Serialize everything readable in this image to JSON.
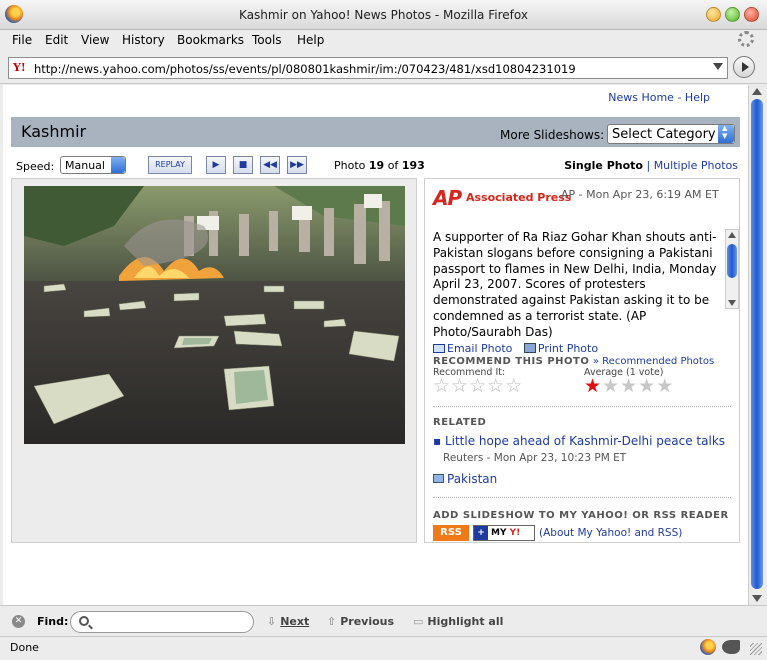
{
  "window": {
    "title": "Kashmir on Yahoo! News Photos - Mozilla Firefox"
  },
  "menu": [
    "File",
    "Edit",
    "View",
    "History",
    "Bookmarks",
    "Tools",
    "Help"
  ],
  "address": {
    "favicon_text": "Y!",
    "url": "http://news.yahoo.com/photos/ss/events/pl/080801kashmir/im:/070423/481/xsd10804231019"
  },
  "toplinks": {
    "home": "News Home",
    "sep": "-",
    "help": "Help"
  },
  "header": {
    "title": "Kashmir",
    "more_label": "More Slideshows:",
    "select_value": "Select Category"
  },
  "controls": {
    "speed_label": "Speed:",
    "speed_value": "Manual",
    "replay": "REPLAY",
    "photo_label": "Photo",
    "photo_num": "19",
    "of_label": "of",
    "photo_total": "193",
    "single": "Single Photo",
    "sep": "|",
    "multiple": "Multiple Photos"
  },
  "info": {
    "ap_logo": "AP",
    "ap_name": "Associated Press",
    "date": "AP - Mon Apr 23, 6:19 AM ET",
    "caption": "A supporter of Ra Riaz Gohar Khan shouts anti-Pakistan slogans before consigning a Pakistani passport to flames in New Delhi, India, Monday April 23, 2007. Scores of protesters demonstrated against Pakistan asking it to be condemned as a terrorist state. (AP Photo/Saurabh Das)",
    "email": "Email Photo",
    "print": "Print Photo",
    "recommend_title": "RECOMMEND THIS PHOTO",
    "recommended_link": "» Recommended Photos",
    "recommend_it": "Recommend It:",
    "average": "Average (1 vote)",
    "average_rating": 1,
    "rating_max": 5,
    "related_title": "RELATED",
    "related_link": "Little hope ahead of Kashmir-Delhi peace talks",
    "related_source": "Reuters - Mon Apr 23, 10:23 PM ET",
    "pakistan": "Pakistan",
    "add_title": "ADD SLIDESHOW TO MY YAHOO! OR RSS READER",
    "rss": "RSS",
    "my_yahoo": "MY",
    "my_yahoo_y": "Y!",
    "about": "(About My Yahoo! and RSS)"
  },
  "findbar": {
    "label": "Find:",
    "input_value": "",
    "next": "Next",
    "previous": "Previous",
    "highlight": "Highlight all"
  },
  "status": {
    "text": "Done"
  },
  "colors": {
    "link": "#1f3b9f",
    "header_band": "#a8b3bf",
    "ap_red": "#d8261c",
    "star_on": "#e01010",
    "rss": "#f07a18"
  }
}
